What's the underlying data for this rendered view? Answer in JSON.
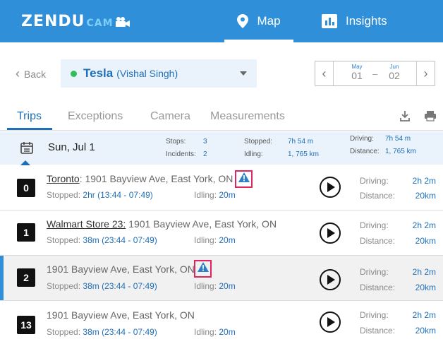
{
  "header": {
    "logo_main": "ZENDU",
    "logo_sub": "CAM",
    "nav": [
      {
        "label": "Map",
        "icon": "map-pin-icon",
        "active": true
      },
      {
        "label": "Insights",
        "icon": "bar-chart-icon",
        "active": false
      }
    ],
    "colors": {
      "bar": "#2f8fd8",
      "accent": "#1f6fb8"
    }
  },
  "toolbar": {
    "back_label": "Back",
    "vehicle_name": "Tesla",
    "vehicle_driver": "(Vishal Singh)",
    "vehicle_status_color": "#2fbe5a",
    "date_from": {
      "month": "May",
      "day": "01"
    },
    "date_to": {
      "month": "Jun",
      "day": "02"
    },
    "date_separator": "–"
  },
  "tabs": [
    {
      "label": "Trips",
      "active": true
    },
    {
      "label": "Exceptions",
      "active": false
    },
    {
      "label": "Camera",
      "active": false
    },
    {
      "label": "Measurements",
      "active": false
    }
  ],
  "summary": {
    "date": "Sun, Jul 1",
    "stops_label": "Stops:",
    "stops_value": "3",
    "incidents_label": "Incidents:",
    "incidents_value": "2",
    "stopped_label": "Stopped:",
    "stopped_value": "7h 54 m",
    "idling_label": "Idling:",
    "idling_value": "1, 765 km",
    "driving_label": "Driving:",
    "driving_value": "7h 54 m",
    "distance_label": "Distance:",
    "distance_value": "1, 765 km"
  },
  "trips": [
    {
      "number": "0",
      "place": "Toronto",
      "address_rest": ": 1901 Bayview Ave, East York, ON",
      "warning": true,
      "stopped_label": "Stopped:",
      "stopped_value": "2hr (13:44 - 07:49)",
      "idling_label": "Idling:",
      "idling_value": "20m",
      "driving_label": "Driving:",
      "driving_value": "2h 2m",
      "distance_label": "Distance:",
      "distance_value": "20km"
    },
    {
      "number": "1",
      "place": "Walmart Store 23:",
      "address_rest": " 1901 Bayview Ave, East York, ON",
      "warning": false,
      "stopped_label": "Stopped:",
      "stopped_value": "38m (23:44 - 07:49)",
      "idling_label": "Idling:",
      "idling_value": "20m",
      "driving_label": "Driving:",
      "driving_value": "2h 2m",
      "distance_label": "Distance:",
      "distance_value": "20km"
    },
    {
      "number": "2",
      "place": "",
      "address_rest": "1901 Bayview Ave, East York, ON",
      "warning": true,
      "selected": true,
      "stopped_label": "Stopped:",
      "stopped_value": "38m (23:44 - 07:49)",
      "idling_label": "Idling:",
      "idling_value": "20m",
      "driving_label": "Driving:",
      "driving_value": "2h 2m",
      "distance_label": "Distance:",
      "distance_value": "20km"
    },
    {
      "number": "13",
      "place": "",
      "address_rest": "1901 Bayview Ave, East York, ON",
      "warning": false,
      "stopped_label": "Stopped:",
      "stopped_value": "38m (23:44 - 07:49)",
      "idling_label": "Idling:",
      "idling_value": "20m",
      "driving_label": "Driving:",
      "driving_value": "2h 2m",
      "distance_label": "Distance:",
      "distance_value": "20km"
    }
  ]
}
